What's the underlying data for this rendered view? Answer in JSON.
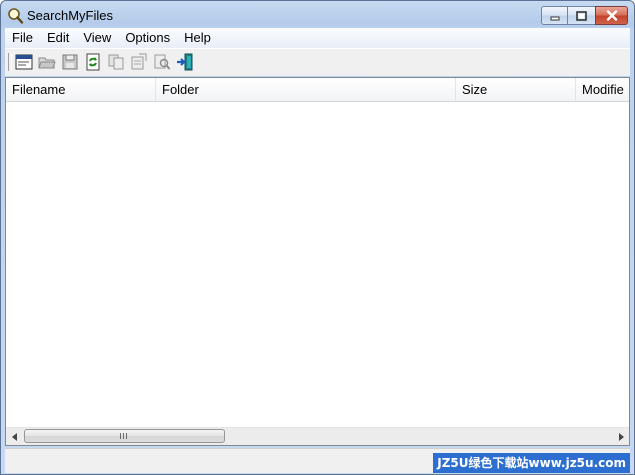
{
  "window": {
    "title": "SearchMyFiles"
  },
  "menu": [
    {
      "label": "File"
    },
    {
      "label": "Edit"
    },
    {
      "label": "View"
    },
    {
      "label": "Options"
    },
    {
      "label": "Help"
    }
  ],
  "toolbar": {
    "icons": [
      "search-options-icon",
      "open-folder-icon",
      "save-icon",
      "refresh-icon",
      "copy-icon",
      "properties-icon",
      "find-icon",
      "exit-icon"
    ]
  },
  "list": {
    "columns": [
      {
        "label": "Filename"
      },
      {
        "label": "Folder"
      },
      {
        "label": "Size"
      },
      {
        "label": "Modifie"
      }
    ],
    "rows": []
  },
  "watermark": {
    "text": "JZ5U绿色下载站www.jz5u.com"
  },
  "colors": {
    "accent": "#2d6fd0",
    "titlebar": "#b4cbea",
    "close": "#c4412b"
  }
}
